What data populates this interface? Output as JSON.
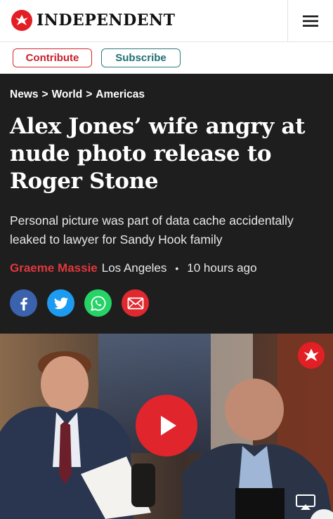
{
  "header": {
    "logo_text": "INDEPENDENT",
    "logo_icon": "eagle-logo-icon",
    "menu_icon": "hamburger-menu-icon"
  },
  "actions": {
    "contribute_label": "Contribute",
    "subscribe_label": "Subscribe"
  },
  "breadcrumb": [
    {
      "label": "News"
    },
    {
      "label": "World"
    },
    {
      "label": "Americas"
    }
  ],
  "breadcrumb_separator": ">",
  "article": {
    "headline": "Alex Jones’ wife angry at nude photo release to Roger Stone",
    "standfirst": "Personal picture was part of data cache accidentally leaked to lawyer for Sandy Hook family",
    "author": "Graeme Massie",
    "location": "Los Angeles",
    "separator": "•",
    "time": "10 hours ago"
  },
  "share": [
    {
      "name": "facebook",
      "icon": "facebook-icon",
      "color": "#3b62ad"
    },
    {
      "name": "twitter",
      "icon": "twitter-icon",
      "color": "#1d9bf0"
    },
    {
      "name": "whatsapp",
      "icon": "whatsapp-icon",
      "color": "#25d366"
    },
    {
      "name": "email",
      "icon": "email-icon",
      "color": "#e0282f"
    }
  ],
  "video": {
    "play_icon": "play-icon",
    "watermark_icon": "eagle-logo-icon",
    "airplay_icon": "airplay-icon"
  },
  "colors": {
    "brand_red": "#e31f26",
    "author_red": "#e2373d",
    "subscribe_teal": "#1f6e74",
    "article_bg": "#1e1e1e"
  }
}
